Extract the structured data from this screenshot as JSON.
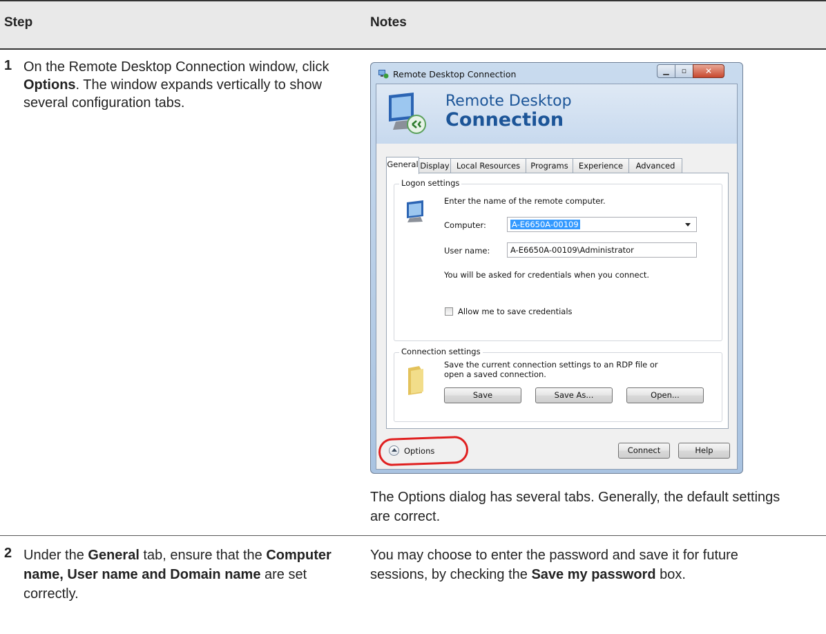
{
  "header": {
    "step": "Step",
    "notes": "Notes"
  },
  "rows": [
    {
      "number": "1",
      "text_before": "On the Remote Desktop Connection window, click ",
      "bold1": "Options",
      "text_after": ". The window expands vertically to show several configuration tabs.",
      "note": "The Options dialog has several tabs. Generally, the default settings are correct."
    },
    {
      "number": "2",
      "text_a": "Under the ",
      "bold_a": "General",
      "text_b": " tab, ensure that the ",
      "bold_b": "Computer name, User name and Domain name",
      "text_c": " are set correctly.",
      "note_a": "You may choose to enter the password and save it for future sessions, by checking the ",
      "note_bold": "Save my password",
      "note_b": " box."
    }
  ],
  "dialog": {
    "title": "Remote Desktop Connection",
    "banner_line1": "Remote Desktop",
    "banner_line2": "Connection",
    "tabs": [
      "General",
      "Display",
      "Local Resources",
      "Programs",
      "Experience",
      "Advanced"
    ],
    "logon": {
      "group_label": "Logon settings",
      "instruction": "Enter the name of the remote computer.",
      "computer_label": "Computer:",
      "computer_value": "A-E6650A-00109",
      "username_label": "User name:",
      "username_value": "A-E6650A-00109\\Administrator",
      "credentials_note": "You will be asked for credentials when you connect.",
      "allow_save_label": "Allow me to save credentials"
    },
    "connection": {
      "group_label": "Connection settings",
      "description": "Save the current connection settings to an RDP file or open a saved connection.",
      "save": "Save",
      "save_as": "Save As...",
      "open": "Open..."
    },
    "options_label": "Options",
    "connect": "Connect",
    "help": "Help"
  }
}
